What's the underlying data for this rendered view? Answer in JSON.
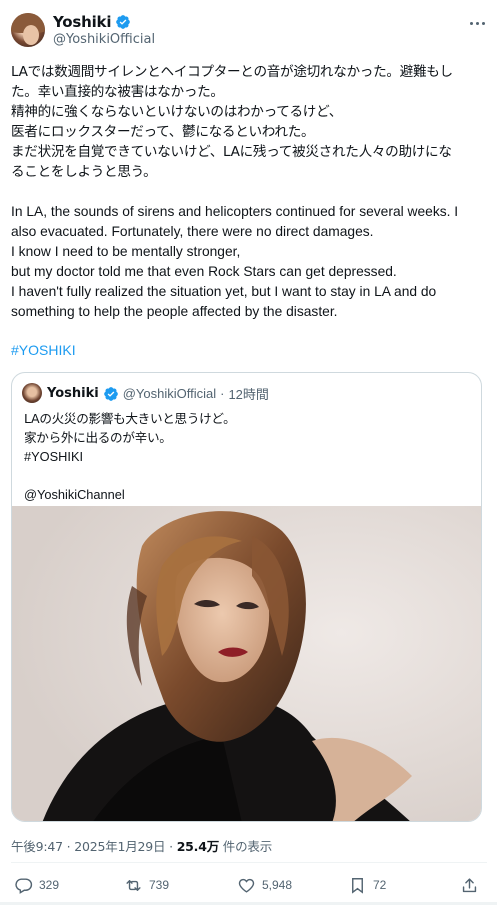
{
  "author": {
    "display_name": "Yoshiki",
    "handle": "@YoshikiOfficial"
  },
  "more_icon": "more-horizontal-icon",
  "body": {
    "ja_lines": [
      "LAでは数週間サイレンとヘイコプターとの音が途切れなかった。避難もし",
      "た。幸い直接的な被害はなかった。",
      "精神的に強くならないといけないのはわかってるけど、",
      "医者にロックスターだって、鬱になるといわれた。",
      "まだ状況を自覚できていないけど、LAに残って被災された人々の助けにな",
      "ることをしようと思う。"
    ],
    "en_lines": [
      "In LA, the sounds of sirens and helicopters continued for several weeks. I",
      "also evacuated. Fortunately, there were no direct damages.",
      "I know I need to be mentally stronger,",
      "but my doctor told me that even Rock Stars can get depressed.",
      "I haven't fully realized the situation yet, but I want to stay in LA and do",
      "something to help the people affected by the disaster."
    ],
    "hashtag": "#YOSHIKI"
  },
  "quote": {
    "display_name": "Yoshiki",
    "handle": "@YoshikiOfficial",
    "dot": "·",
    "time": "12時間",
    "lines": [
      "LAの火災の影響も大きいと思うけど。",
      "家から外に出るのが辛い。",
      "#YOSHIKI"
    ],
    "mention": "@YoshikiChannel"
  },
  "timestamp": {
    "time_date": "午後9:47 · 2025年1月29日 · ",
    "views_count": "25.4万",
    "views_label": " 件の表示"
  },
  "actions": {
    "reply_count": "329",
    "repost_count": "739",
    "like_count": "5,948",
    "bookmark_count": "72"
  },
  "colors": {
    "link": "#1d9bf0",
    "secondary_text": "#536471",
    "verified": "#1d9bf0"
  }
}
